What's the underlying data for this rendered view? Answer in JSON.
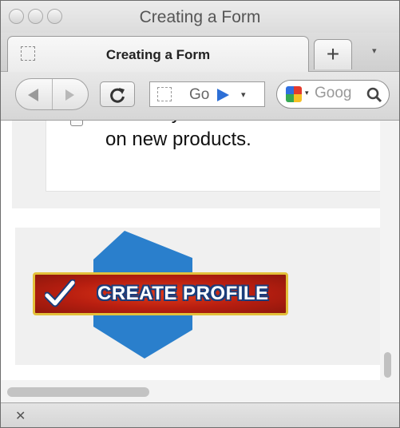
{
  "window": {
    "title": "Creating a Form"
  },
  "tabs": [
    {
      "label": "Creating a Form",
      "active": true
    }
  ],
  "toolbar": {
    "new_tab_glyph": "+",
    "tab_menu_glyph": "▾",
    "url_text": "Go",
    "url_drop_glyph": "▾",
    "search_placeholder": "Goog",
    "search_drop_glyph": "▾"
  },
  "form": {
    "consent_text": "It is okay to email me with offers on new products.",
    "checkbox_checked": false
  },
  "cta": {
    "label": "CREATE PROFILE",
    "icon": "checkmark-icon"
  },
  "statusbar": {
    "close_glyph": "✕"
  },
  "colors": {
    "cta_red": "#c12a13",
    "cta_border": "#e3c03a",
    "cta_shape_blue": "#2a7fcc",
    "cta_text_outline": "#1b3d7a",
    "panel_gray": "#f0f0f0"
  }
}
